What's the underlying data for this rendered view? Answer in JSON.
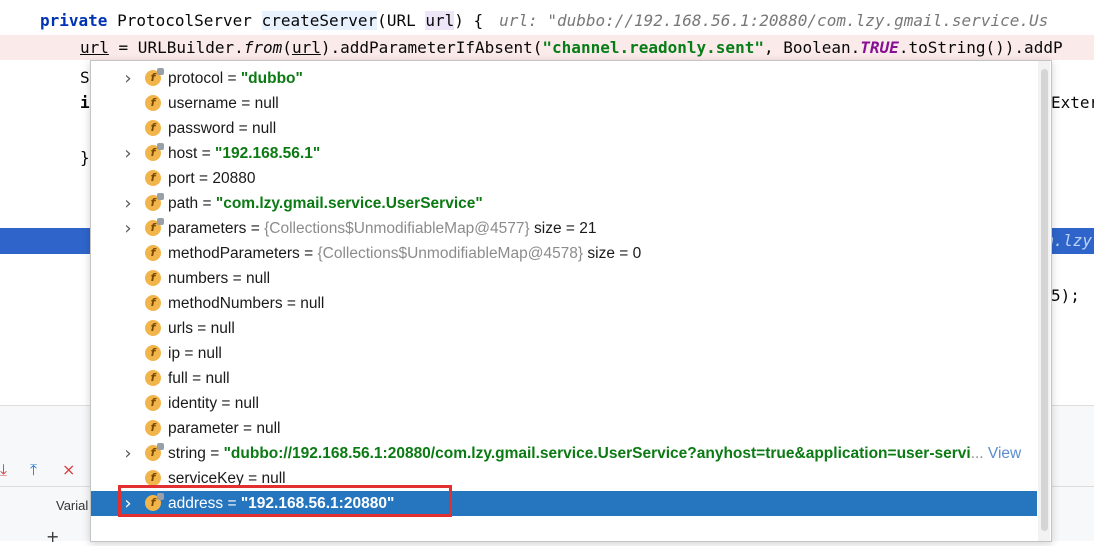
{
  "editor": {
    "sig": {
      "kw_private": "private",
      "type": "ProtocolServer",
      "fn": "createServer",
      "paren_open": "(",
      "param_type": "URL",
      "param_name": "url",
      "paren_close": ") {",
      "hint": "url: \"dubbo://192.168.56.1:20880/com.lzy.gmail.service.Us"
    },
    "url_line": {
      "lhs": "url",
      "mid": " = URLBuilder.",
      "from": "from",
      "call_open": "(",
      "arg": "url",
      "call_mid": ").addParameterIfAbsent(",
      "str": "\"channel.readonly.sent\"",
      "sep": ", Boolean.",
      "const": "TRUE",
      "tail": ".toString()).addP"
    },
    "frag_s": "S",
    "frag_i": "i",
    "frag_brace": "}",
    "frag_exter": "Exter",
    "frag_5": "5);",
    "frag_exec": "m.lzy"
  },
  "toolbar": {
    "icon_down_color": "#d93a3a",
    "icon_up_color": "#2a7bd4",
    "icon_x_color": "#d93a3a"
  },
  "bottom": {
    "variables_tab": "Varial",
    "plus": "+"
  },
  "popup": {
    "rows": [
      {
        "name": "protocol",
        "eq": " = ",
        "value": "\"dubbo\"",
        "kind": "str",
        "expandable": true
      },
      {
        "name": "username",
        "eq": " = ",
        "value": "null",
        "kind": "plain",
        "expandable": false
      },
      {
        "name": "password",
        "eq": " = ",
        "value": "null",
        "kind": "plain",
        "expandable": false
      },
      {
        "name": "host",
        "eq": " = ",
        "value": "\"192.168.56.1\"",
        "kind": "str",
        "expandable": true
      },
      {
        "name": "port",
        "eq": " = ",
        "value": "20880",
        "kind": "plain",
        "expandable": false
      },
      {
        "name": "path",
        "eq": " = ",
        "value": "\"com.lzy.gmail.service.UserService\"",
        "kind": "str",
        "expandable": true
      },
      {
        "name": "parameters",
        "eq": " = ",
        "value": "{Collections$UnmodifiableMap@4577}",
        "kind": "ref",
        "extra": "  size = 21",
        "expandable": true
      },
      {
        "name": "methodParameters",
        "eq": " = ",
        "value": "{Collections$UnmodifiableMap@4578}",
        "kind": "ref",
        "extra": "  size = 0",
        "expandable": false
      },
      {
        "name": "numbers",
        "eq": " = ",
        "value": "null",
        "kind": "plain",
        "expandable": false
      },
      {
        "name": "methodNumbers",
        "eq": " = ",
        "value": "null",
        "kind": "plain",
        "expandable": false
      },
      {
        "name": "urls",
        "eq": " = ",
        "value": "null",
        "kind": "plain",
        "expandable": false
      },
      {
        "name": "ip",
        "eq": " = ",
        "value": "null",
        "kind": "plain",
        "expandable": false
      },
      {
        "name": "full",
        "eq": " = ",
        "value": "null",
        "kind": "plain",
        "expandable": false
      },
      {
        "name": "identity",
        "eq": " = ",
        "value": "null",
        "kind": "plain",
        "expandable": false
      },
      {
        "name": "parameter",
        "eq": " = ",
        "value": "null",
        "kind": "plain",
        "expandable": false
      },
      {
        "name": "string",
        "eq": " = ",
        "value": "\"dubbo://192.168.56.1:20880/com.lzy.gmail.service.UserService?anyhost=true&application=user-servi",
        "kind": "str",
        "ellipsis": "...",
        "link": " View",
        "expandable": true
      },
      {
        "name": "serviceKey",
        "eq": " = ",
        "value": "null",
        "kind": "plain",
        "expandable": false
      },
      {
        "name": "address",
        "eq": " = ",
        "value": "\"192.168.56.1:20880\"",
        "kind": "str",
        "expandable": true,
        "selected": true
      }
    ],
    "field_icon_letter": "f"
  }
}
